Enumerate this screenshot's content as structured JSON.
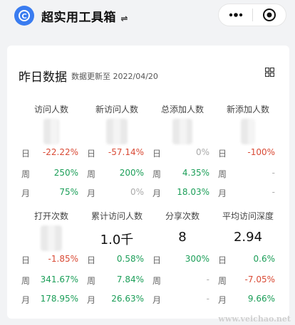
{
  "app": {
    "title": "超实用工具箱",
    "title_suffix": "⇌"
  },
  "card": {
    "title": "昨日数据",
    "subtitle": "数据更新至 2022/04/20"
  },
  "row_labels": {
    "day": "日",
    "week": "周",
    "month": "月"
  },
  "top_metrics": [
    {
      "name": "访问人数",
      "big": "",
      "day": "-22.22%",
      "week": "250%",
      "month": "75%",
      "day_color": "red",
      "week_color": "green",
      "month_color": "green"
    },
    {
      "name": "新访问人数",
      "big": "",
      "day": "-57.14%",
      "week": "200%",
      "month": "0%",
      "day_color": "red",
      "week_color": "green",
      "month_color": "gray"
    },
    {
      "name": "总添加人数",
      "big": "",
      "day": "0%",
      "week": "4.35%",
      "month": "18.03%",
      "day_color": "gray",
      "week_color": "green",
      "month_color": "green"
    },
    {
      "name": "新添加人数",
      "big": "",
      "day": "-100%",
      "week": "-",
      "month": "-",
      "day_color": "red",
      "week_color": "gray",
      "month_color": "gray"
    }
  ],
  "bottom_metrics": [
    {
      "name": "打开次数",
      "big": "",
      "day": "-1.85%",
      "week": "341.67%",
      "month": "178.95%",
      "day_color": "red",
      "week_color": "green",
      "month_color": "green"
    },
    {
      "name": "累计访问人数",
      "big": "1.0千",
      "day": "0.58%",
      "week": "7.84%",
      "month": "26.63%",
      "day_color": "green",
      "week_color": "green",
      "month_color": "green"
    },
    {
      "name": "分享次数",
      "big": "8",
      "day": "300%",
      "week": "-",
      "month": "-",
      "day_color": "green",
      "week_color": "gray",
      "month_color": "gray"
    },
    {
      "name": "平均访问深度",
      "big": "2.94",
      "day": "0.6%",
      "week": "-7.05%",
      "month": "9.66%",
      "day_color": "green",
      "week_color": "red",
      "month_color": "green"
    }
  ],
  "watermark": "www.veichao.net",
  "colors": {
    "red": "#d94a35",
    "green": "#1b9e58",
    "gray": "#aaaaaa",
    "accent": "#3a7cf0"
  }
}
